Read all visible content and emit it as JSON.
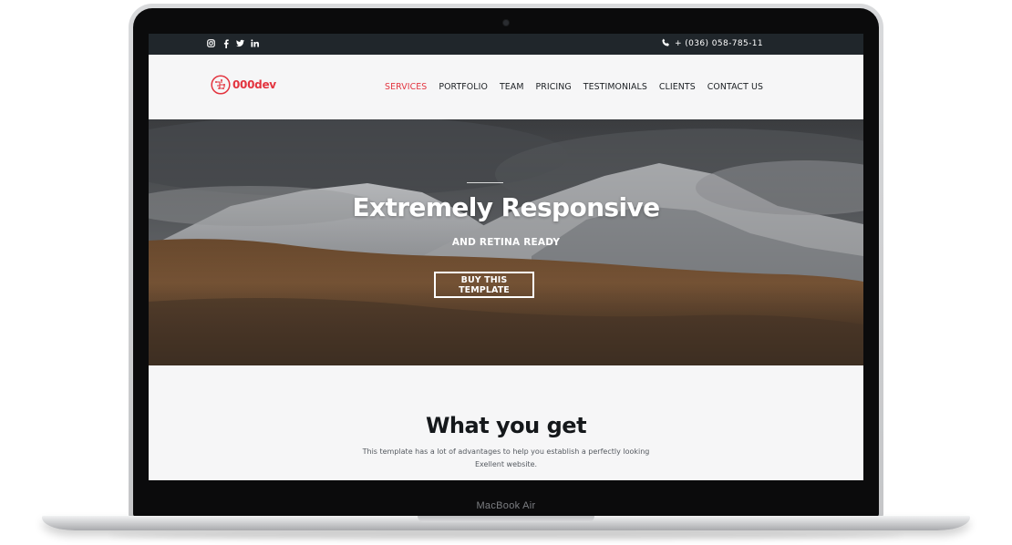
{
  "device": {
    "label": "MacBook Air"
  },
  "topbar": {
    "social_icons": [
      "instagram-icon",
      "facebook-icon",
      "twitter-icon",
      "linkedin-icon"
    ],
    "phone_icon": "phone-icon",
    "phone": "+ (036) 058-785-11"
  },
  "navbar": {
    "logo_text": "000dev",
    "menu": [
      {
        "label": "SERVICES",
        "active": true
      },
      {
        "label": "PORTFOLIO",
        "active": false
      },
      {
        "label": "TEAM",
        "active": false
      },
      {
        "label": "PRICING",
        "active": false
      },
      {
        "label": "TESTIMONIALS",
        "active": false
      },
      {
        "label": "CLIENTS",
        "active": false
      },
      {
        "label": "CONTACT US",
        "active": false
      }
    ]
  },
  "hero": {
    "title": "Extremely Responsive",
    "subtitle": "AND RETINA READY",
    "button": "BUY THIS TEMPLATE"
  },
  "section": {
    "title": "What you get",
    "desc_line1": "This template has a lot of advantages to help you establish a perfectly looking",
    "desc_line2": "Exellent website."
  },
  "colors": {
    "accent": "#e3343f",
    "topbar": "#20262b",
    "nav_bg": "#f6f6f7"
  }
}
